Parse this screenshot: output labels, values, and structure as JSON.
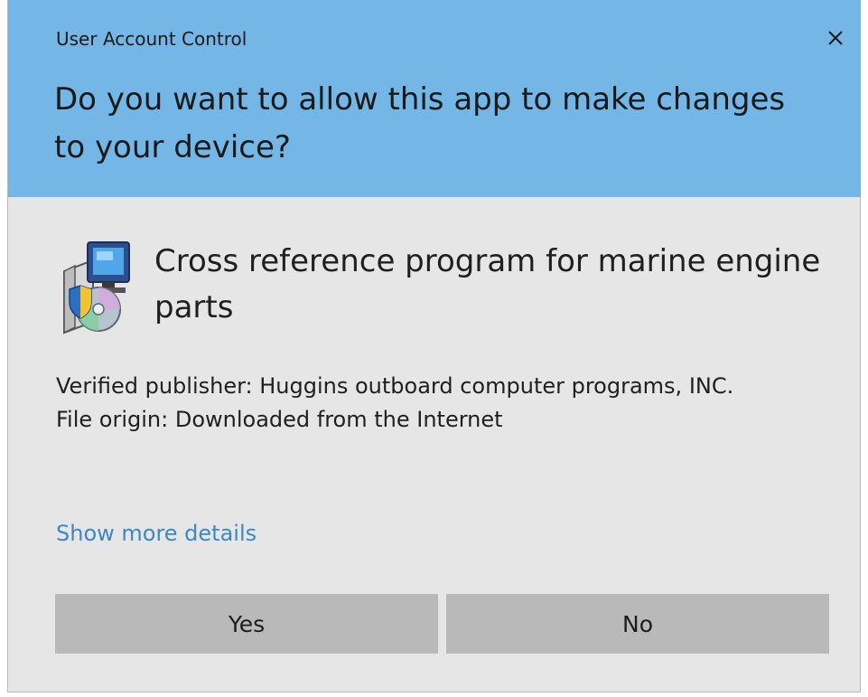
{
  "dialog": {
    "window_title": "User Account Control",
    "question": "Do you want to allow this app to make changes to your device?",
    "app_name": "Cross reference program for marine engine parts",
    "publisher_line": "Verified publisher: Huggins outboard computer programs, INC.",
    "origin_line": "File origin: Downloaded from the Internet",
    "details_link": "Show more details",
    "yes_label": "Yes",
    "no_label": "No"
  },
  "icons": {
    "close": "close-icon",
    "app": "installer-icon"
  },
  "colors": {
    "header_bg": "#74b6e6",
    "body_bg": "#e6e6e6",
    "button_bg": "#b9b9b9",
    "link": "#3d88c4"
  }
}
